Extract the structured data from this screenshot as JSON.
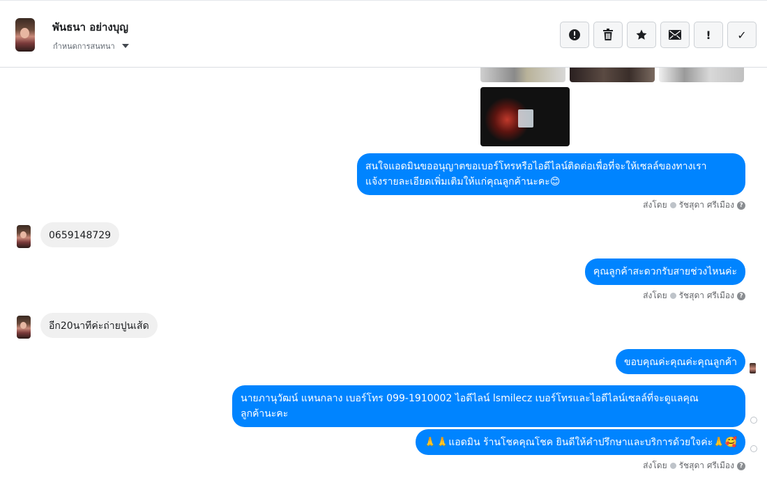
{
  "header": {
    "contact_name": "พันธนา อย่างบุญ",
    "assign_label": "กำหนดการสนทนา",
    "toolbar": [
      {
        "icon": "alert-circle-icon",
        "name": "spam-button"
      },
      {
        "icon": "trash-icon",
        "name": "delete-button"
      },
      {
        "icon": "star-icon",
        "name": "follow-up-button"
      },
      {
        "icon": "envelope-icon",
        "name": "mark-unread-button"
      },
      {
        "icon": "exclamation-icon",
        "name": "priority-button",
        "glyph": "!"
      },
      {
        "icon": "check-icon",
        "name": "done-button",
        "glyph": "✓"
      }
    ]
  },
  "thread": {
    "messages": [
      {
        "dir": "out",
        "text_line1": "สนใจแอดมินขออนุญาตขอเบอร์โทรหรือไอดีไลน์ติดต่อเพื่อที่จะให้เซลล์ของทางเรา",
        "text_line2": "แจ้งรายละเอียดเพิ่มเติมให้แก่คุณลูกค้านะคะ😊"
      },
      {
        "dir": "in",
        "text": "0659148729"
      },
      {
        "dir": "out",
        "text": "คุณลูกค้าสะดวกรับสายช่วงไหนค่ะ"
      },
      {
        "dir": "in",
        "text": "อีก20นาทีค่ะถ่ายปูนเส้ด"
      },
      {
        "dir": "out",
        "text": "ขอบคุณค่ะคุณค่ะคุณลูกค้า"
      },
      {
        "dir": "out",
        "text_line1": "นายภานุวัฒน์ แหนกลาง เบอร์โทร 099-1910002 ไอดีไลน์ lsmilecz   เบอร์โทรและไอดีไลน์เซลล์ที่จะดูแลคุณ",
        "text_line2": "ลูกค้านะคะ"
      },
      {
        "dir": "out",
        "text": "🙏🙏แอดมิน ร้านโชคคุณโชค ยินดีให้คำปรึกษาและบริการด้วยใจค่ะ🙏🥰"
      }
    ],
    "sent_by_label": "ส่งโดย",
    "sender_name": "รัชสุดา ศรีเมือง",
    "help_glyph": "?"
  },
  "colors": {
    "outgoing_bubble": "#0084ff",
    "incoming_bubble": "#f0f0f0"
  }
}
